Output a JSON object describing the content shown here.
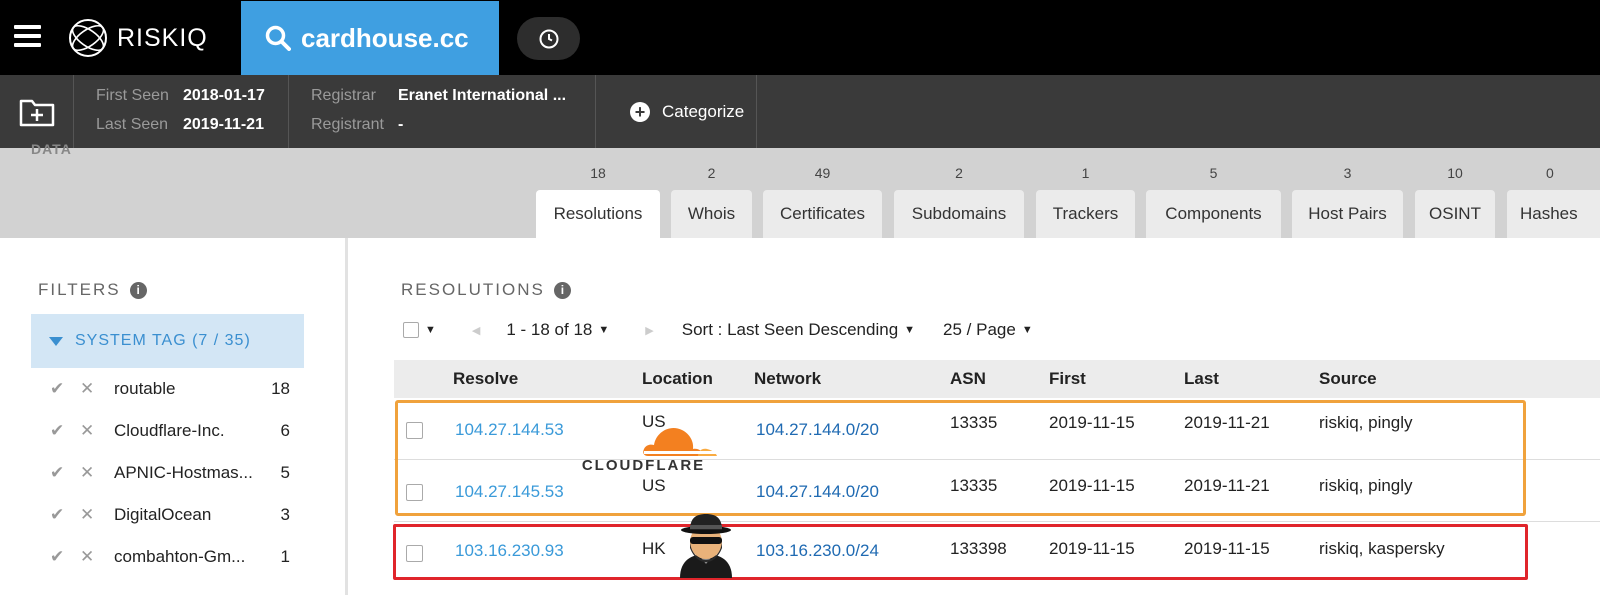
{
  "app": {
    "brand": "RISKIQ",
    "search_query": "cardhouse.cc"
  },
  "info": {
    "first_seen_label": "First Seen",
    "first_seen": "2018-01-17",
    "last_seen_label": "Last Seen",
    "last_seen": "2019-11-21",
    "registrar_label": "Registrar",
    "registrar": "Eranet International ...",
    "registrant_label": "Registrant",
    "registrant": "-",
    "categorize_label": "Categorize"
  },
  "data_section_label": "DATA",
  "tabs": [
    {
      "label": "Resolutions",
      "count": "18"
    },
    {
      "label": "Whois",
      "count": "2"
    },
    {
      "label": "Certificates",
      "count": "49"
    },
    {
      "label": "Subdomains",
      "count": "2"
    },
    {
      "label": "Trackers",
      "count": "1"
    },
    {
      "label": "Components",
      "count": "5"
    },
    {
      "label": "Host Pairs",
      "count": "3"
    },
    {
      "label": "OSINT",
      "count": "10"
    },
    {
      "label": "Hashes",
      "count": "0"
    }
  ],
  "filters": {
    "title": "FILTERS",
    "group_label": "SYSTEM TAG (7 / 35)",
    "items": [
      {
        "name": "routable",
        "count": "18"
      },
      {
        "name": "Cloudflare-Inc.",
        "count": "6"
      },
      {
        "name": "APNIC-Hostmas...",
        "count": "5"
      },
      {
        "name": "DigitalOcean",
        "count": "3"
      },
      {
        "name": "combahton-Gm...",
        "count": "1"
      }
    ]
  },
  "resolutions": {
    "title": "RESOLUTIONS",
    "pagination": "1 - 18 of 18",
    "sort": "Sort : Last Seen Descending",
    "per_page": "25 / Page",
    "columns": [
      "Resolve",
      "Location",
      "Network",
      "ASN",
      "First",
      "Last",
      "Source"
    ],
    "rows": [
      {
        "resolve": "104.27.144.53",
        "location": "US",
        "network": "104.27.144.0/20",
        "asn": "13335",
        "first": "2019-11-15",
        "last": "2019-11-21",
        "source": "riskiq, pingly"
      },
      {
        "resolve": "104.27.145.53",
        "location": "US",
        "network": "104.27.144.0/20",
        "asn": "13335",
        "first": "2019-11-15",
        "last": "2019-11-21",
        "source": "riskiq, pingly"
      },
      {
        "resolve": "103.16.230.93",
        "location": "HK",
        "network": "103.16.230.0/24",
        "asn": "133398",
        "first": "2019-11-15",
        "last": "2019-11-15",
        "source": "riskiq, kaspersky"
      }
    ]
  },
  "overlay": {
    "cloudflare_text": "CLOUDFLARE"
  },
  "colors": {
    "accent": "#3f9fe1",
    "highlight_orange": "#f0a23c",
    "highlight_red": "#e0252b"
  }
}
